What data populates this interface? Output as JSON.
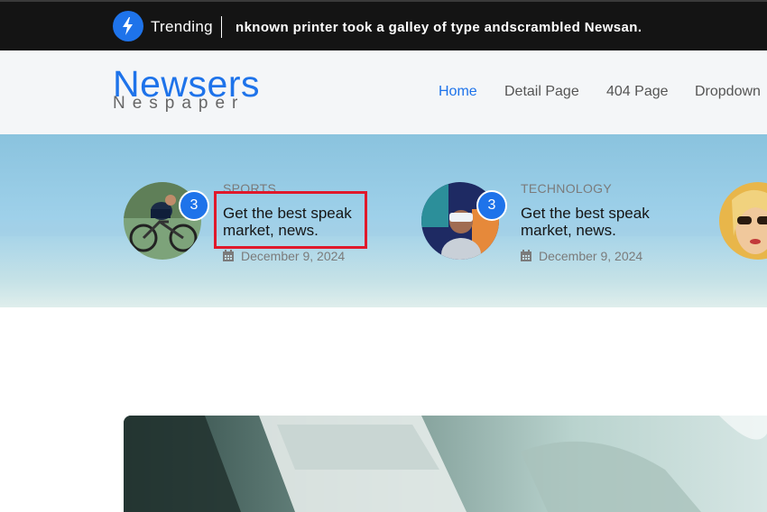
{
  "topbar": {
    "trending_label": "Trending",
    "ticker_text": "nknown printer took a galley of type andscrambled Newsan."
  },
  "header": {
    "logo_main": "Newsers",
    "logo_sub": "Nespaper",
    "nav": [
      "Home",
      "Detail Page",
      "404 Page",
      "Dropdown"
    ]
  },
  "featured": [
    {
      "badge": "3",
      "category": "SPORTS",
      "title": "Get the best speak market, news.",
      "date": "December 9, 2024"
    },
    {
      "badge": "3",
      "category": "TECHNOLOGY",
      "title": "Get the best speak market, news.",
      "date": "December 9, 2024"
    }
  ],
  "colors": {
    "accent": "#1e73ea",
    "topbar_bg": "#141414",
    "highlight": "#e0192b"
  }
}
